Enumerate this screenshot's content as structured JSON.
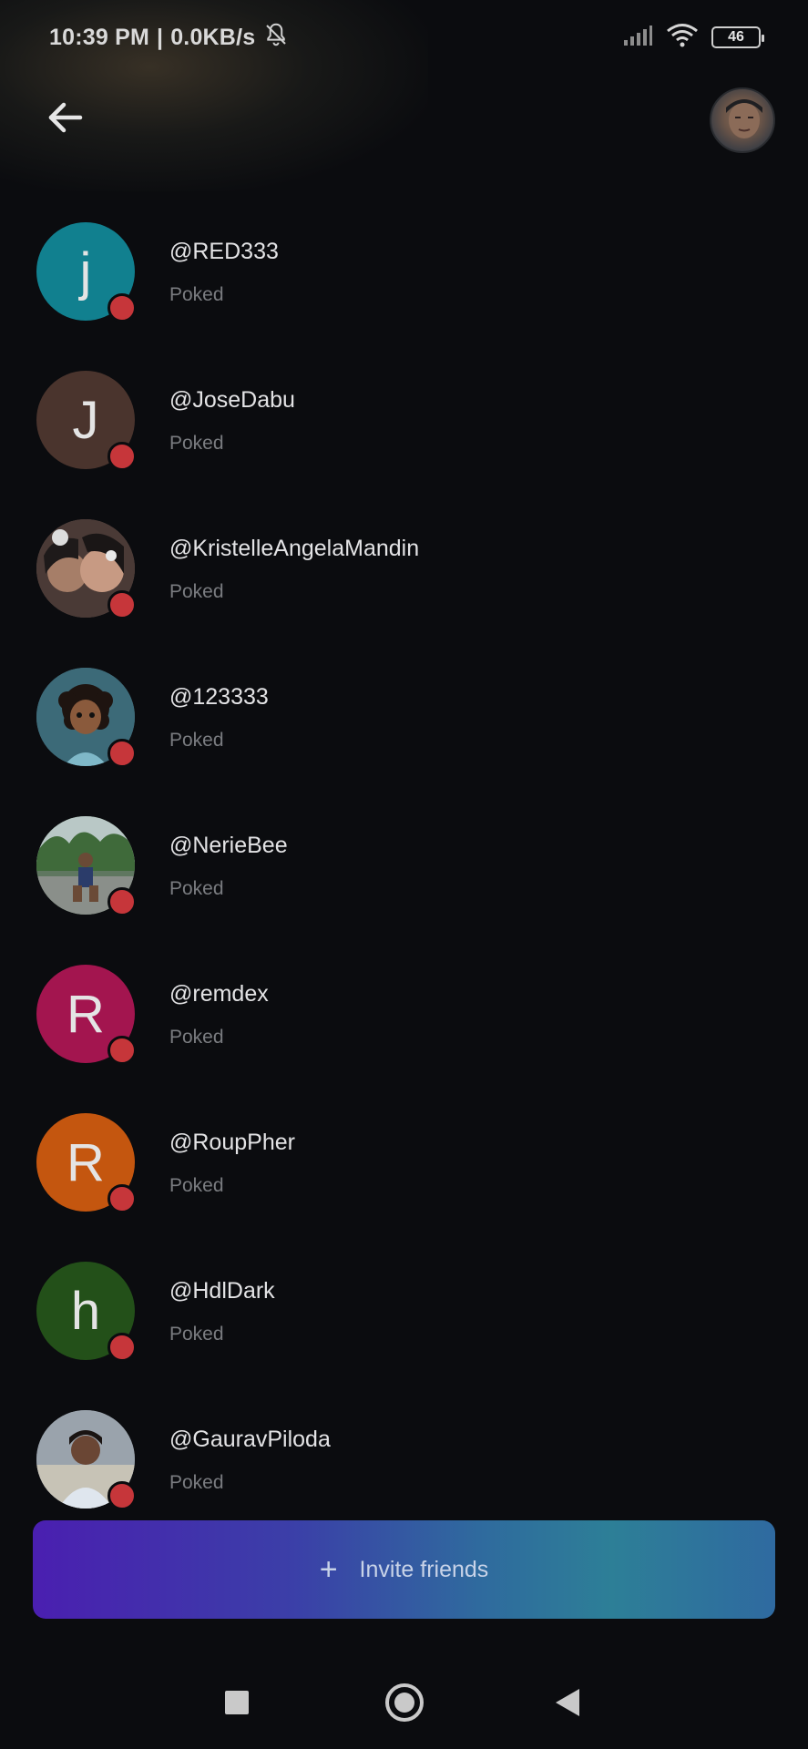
{
  "status_bar": {
    "time": "10:39 PM",
    "separator": "|",
    "speed": "0.0KB/s",
    "battery": "46",
    "icons": [
      "mute-bell-icon",
      "signal-icon",
      "wifi-icon",
      "battery-icon"
    ]
  },
  "header": {
    "back_icon": "arrow-left-icon",
    "profile_avatar": "profile-photo"
  },
  "friends": [
    {
      "username": "@RED333",
      "status": "Poked",
      "initial": "j",
      "avatar_color": "#11808f",
      "avatar_type": "letter"
    },
    {
      "username": "@JoseDabu",
      "status": "Poked",
      "initial": "J",
      "avatar_color": "#4a342d",
      "avatar_type": "letter"
    },
    {
      "username": "@KristelleAngelaMandin",
      "status": "Poked",
      "initial": "",
      "avatar_color": "#6e5a52",
      "avatar_type": "photo"
    },
    {
      "username": "@123333",
      "status": "Poked",
      "initial": "",
      "avatar_color": "#4d6b78",
      "avatar_type": "photo"
    },
    {
      "username": "@NerieBee",
      "status": "Poked",
      "initial": "",
      "avatar_color": "#4f6a4c",
      "avatar_type": "photo"
    },
    {
      "username": "@remdex",
      "status": "Poked",
      "initial": "R",
      "avatar_color": "#a3154f",
      "avatar_type": "letter"
    },
    {
      "username": "@RoupPher",
      "status": "Poked",
      "initial": "R",
      "avatar_color": "#c4560f",
      "avatar_type": "letter"
    },
    {
      "username": "@HdlDark",
      "status": "Poked",
      "initial": "h",
      "avatar_color": "#235019",
      "avatar_type": "letter"
    },
    {
      "username": "@GauravPiloda",
      "status": "Poked",
      "initial": "",
      "avatar_color": "#7c8490",
      "avatar_type": "photo"
    }
  ],
  "colors": {
    "background": "#0b0c0f",
    "status_dot": "#c6363a",
    "invite_gradient_start": "#4a1fb0",
    "invite_gradient_end": "#2d7f97"
  },
  "invite": {
    "icon": "plus-icon",
    "plus": "+",
    "label": "Invite friends"
  },
  "nav": {
    "recents_icon": "square-recents-icon",
    "home_icon": "circle-home-icon",
    "back_icon": "triangle-back-icon"
  }
}
